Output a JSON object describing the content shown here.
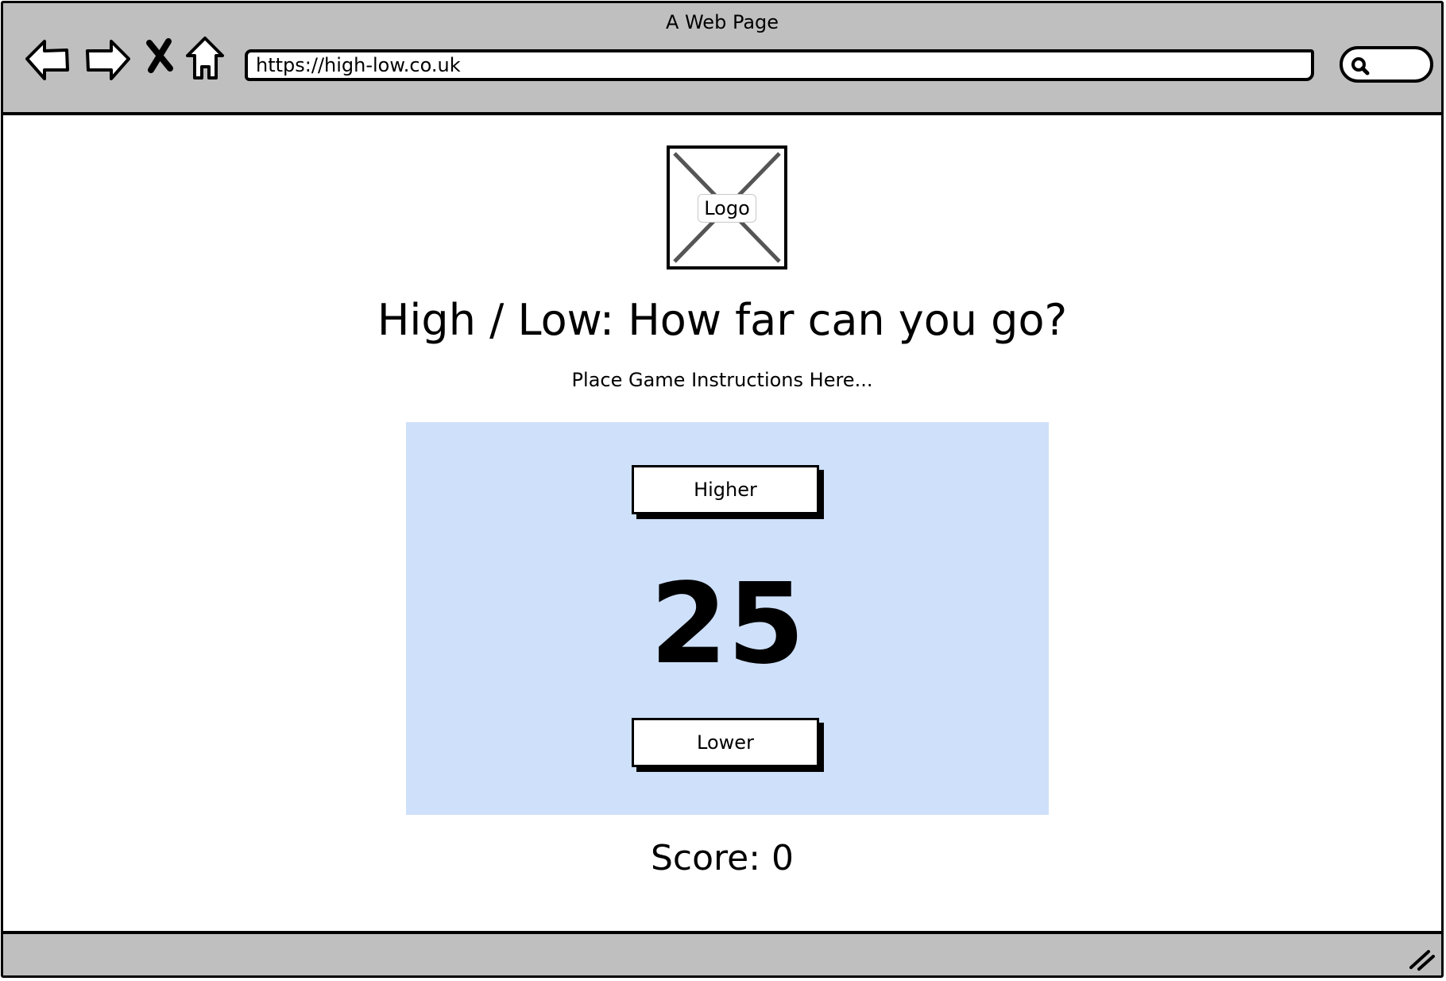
{
  "browser": {
    "window_title": "A Web Page",
    "url": "https://high-low.co.uk",
    "icons": {
      "back": "back-arrow-icon",
      "forward": "forward-arrow-icon",
      "stop": "close-icon",
      "home": "home-icon",
      "search": "search-icon",
      "resize": "resize-grip-icon"
    }
  },
  "page": {
    "logo_label": "Logo",
    "title": "High / Low: How far can you go?",
    "instructions": "Place Game Instructions Here...",
    "game": {
      "higher_label": "Higher",
      "current_number": "25",
      "lower_label": "Lower",
      "panel_color": "#cfe0fa"
    },
    "score_text": "Score: 0"
  }
}
